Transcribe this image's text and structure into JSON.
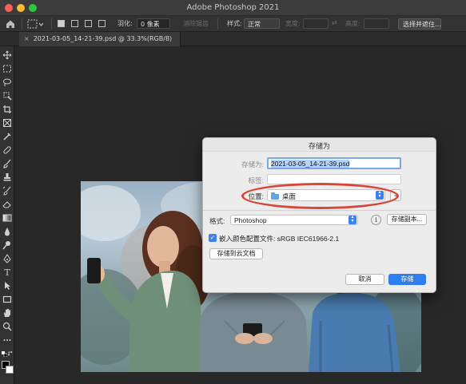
{
  "window": {
    "title": "Adobe Photoshop 2021"
  },
  "options_bar": {
    "feather_label": "羽化:",
    "feather_value": "0 像素",
    "anti_alias_label": "消除锯齿",
    "style_label": "样式:",
    "style_value": "正常",
    "width_label": "宽度:",
    "height_label": "高度:",
    "select_mask_button": "选择并遮住..."
  },
  "document_tab": {
    "close_glyph": "×",
    "label": "2021-03-05_14-21-39.psd @ 33.3%(RGB/8)"
  },
  "toolbar": {
    "text_tool_glyph": "T"
  },
  "save_dialog": {
    "title": "存储为",
    "save_as_label": "存储为:",
    "save_as_value": "2021-03-05_14-21-39.psd",
    "tags_label": "标签:",
    "location_label": "位置:",
    "location_value": "桌面",
    "expand_glyph": "⌄",
    "format_label": "格式:",
    "format_value": "Photoshop",
    "info_glyph": "i",
    "save_copy_button": "存储副本...",
    "embed_profile_checked": true,
    "embed_profile_label": "嵌入颜色配置文件: sRGB IEC61966-2.1",
    "save_to_cloud_button": "存储到云文档",
    "cancel_button": "取消",
    "save_button": "存储"
  }
}
